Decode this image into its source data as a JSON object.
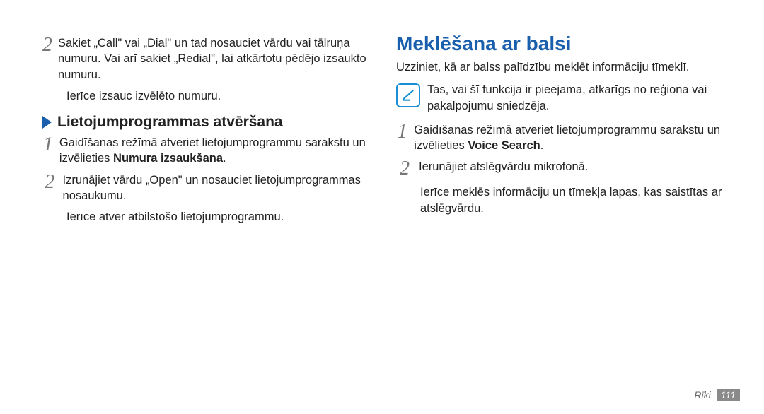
{
  "left": {
    "step2": "Sakiet „Call\" vai „Dial\" un tad nosauciet vārdu vai tālruņa numuru. Vai arī sakiet „Redial\", lai atkārtotu pēdējo izsaukto numuru.",
    "step2_after": "Ierīce izsauc izvēlēto numuru.",
    "subheading": "Lietojumprogrammas atvēršana",
    "s1_a": "Gaidīšanas režīmā atveriet lietojumprogrammu sarakstu un izvēlieties ",
    "s1_b": "Numura izsaukšana",
    "s1_c": ".",
    "s2": "Izrunājiet vārdu „Open\" un nosauciet lietojumprogrammas nosaukumu.",
    "s2_after": "Ierīce atver atbilstošo lietojumprogrammu."
  },
  "right": {
    "title": "Meklēšana ar balsi",
    "lead": "Uzziniet, kā ar balss palīdzību meklēt informāciju tīmeklī.",
    "note": "Tas, vai šī funkcija ir pieejama, atkarīgs no reģiona vai pakalpojumu sniedzēja.",
    "s1_a": "Gaidīšanas režīmā atveriet lietojumprogrammu sarakstu un izvēlieties ",
    "s1_b": "Voice Search",
    "s1_c": ".",
    "s2": "Ierunājiet atslēgvārdu mikrofonā.",
    "s2_after": "Ierīce meklēs informāciju un tīmekļa lapas, kas saistītas ar atslēgvārdu."
  },
  "footer": {
    "section": "Rīki",
    "page": "111"
  },
  "nums": {
    "n1": "1",
    "n2": "2"
  }
}
